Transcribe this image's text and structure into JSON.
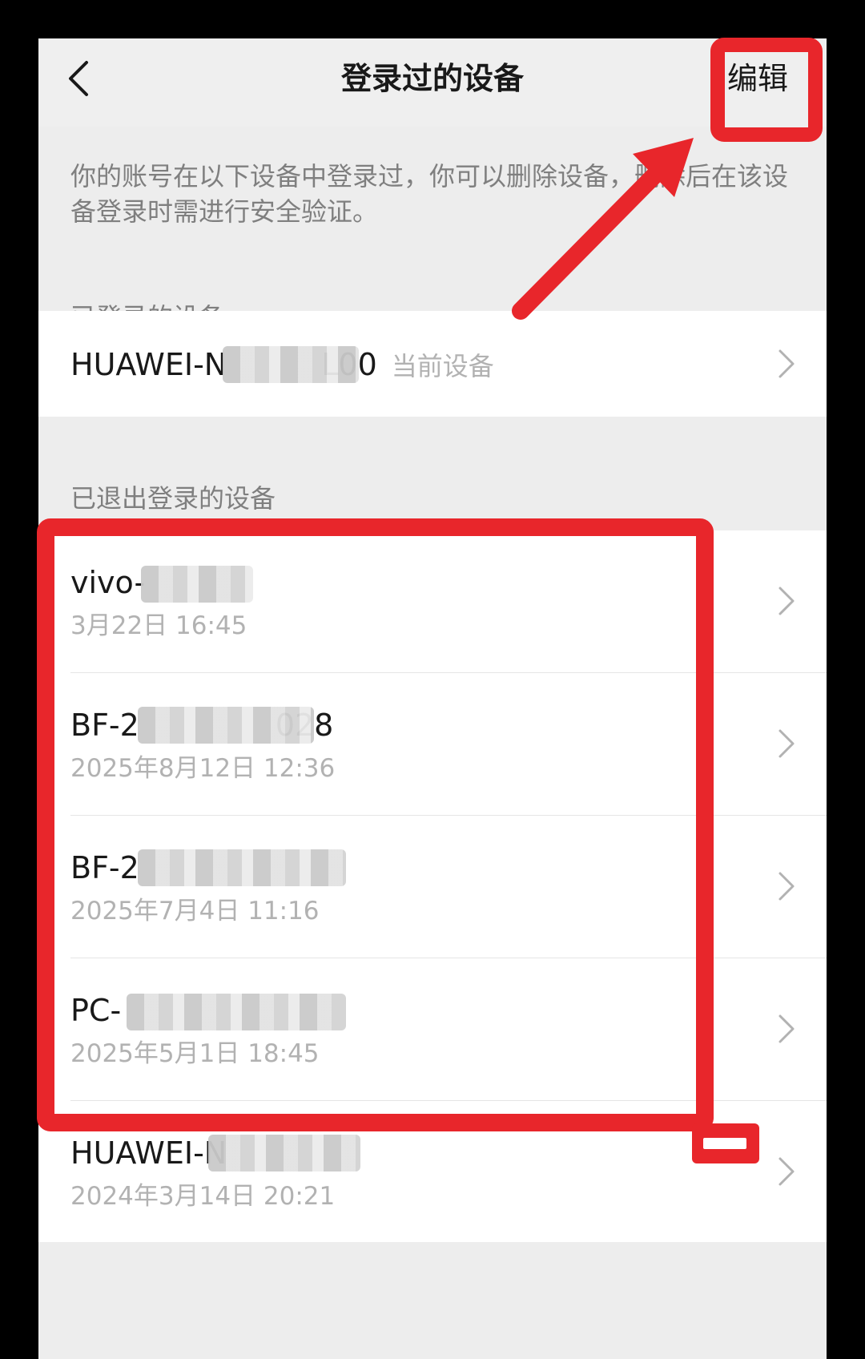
{
  "header": {
    "title": "登录过的设备",
    "edit_label": "编辑"
  },
  "intro_text": "你的账号在以下设备中登录过，你可以删除设备，删除后在该设备登录时需进行安全验证。",
  "logged_in": {
    "label": "已登录的设备",
    "device": {
      "name": "HUAWEI-N",
      "name_tail": "L00",
      "tag": "当前设备"
    }
  },
  "logged_out": {
    "label": "已退出登录的设备",
    "devices": [
      {
        "name": "vivo-",
        "name_tail": "",
        "time": "3月22日 16:45"
      },
      {
        "name": "BF-2",
        "name_tail": "028",
        "time": "2025年8月12日 12:36"
      },
      {
        "name": "BF-2",
        "name_tail": "",
        "time": "2025年7月4日 11:16"
      },
      {
        "name": "PC-",
        "name_tail": "",
        "time": "2025年5月1日 18:45"
      },
      {
        "name": "HUAWEI-N",
        "name_tail": "",
        "time": "2024年3月14日 20:21"
      }
    ]
  },
  "colors": {
    "annotation_red": "#e8262b",
    "text_primary": "#191919",
    "text_secondary": "#7f7f7f",
    "text_tertiary": "#b2b2b2",
    "page_background": "#ededed"
  },
  "icons": {
    "back": "chevron-left-icon",
    "row_arrow": "chevron-right-icon"
  }
}
